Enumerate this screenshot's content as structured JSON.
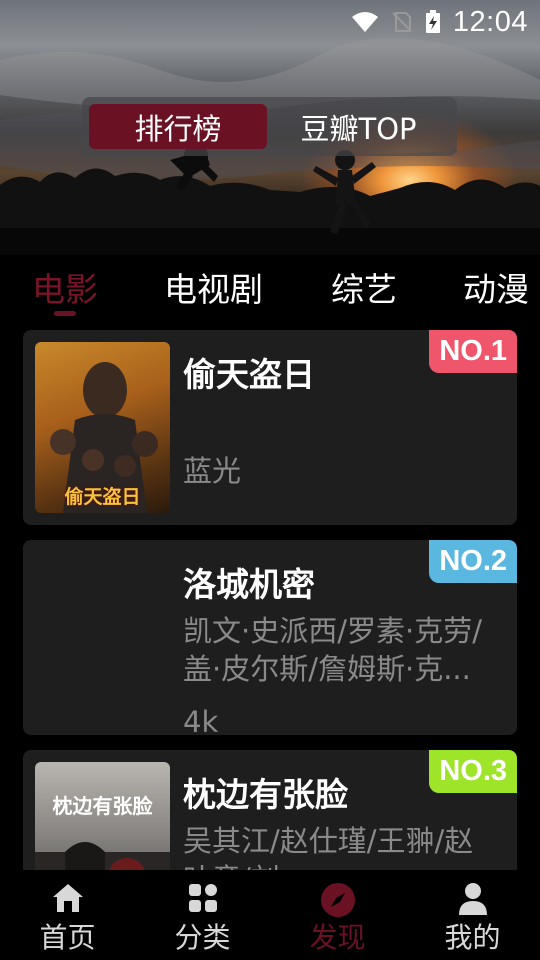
{
  "status_bar": {
    "time": "12:04"
  },
  "hero": {
    "segments": [
      {
        "label": "排行榜",
        "active": true
      },
      {
        "label": "豆瓣TOP",
        "active": false
      }
    ]
  },
  "category_tabs": [
    {
      "label": "电影",
      "active": true
    },
    {
      "label": "电视剧",
      "active": false
    },
    {
      "label": "综艺",
      "active": false
    },
    {
      "label": "动漫",
      "active": false
    }
  ],
  "rankings": [
    {
      "rank_badge": "NO.1",
      "badge_color": "#f0566b",
      "title": "偷天盗日",
      "meta_lines": [
        "蓝光"
      ],
      "poster_text": "偷天盗日"
    },
    {
      "rank_badge": "NO.2",
      "badge_color": "#5ab7e0",
      "title": "洛城机密",
      "meta_lines": [
        "凯文·史派西/罗素·克劳/",
        "盖·皮尔斯/詹姆斯·克..."
      ],
      "quality": "4k"
    },
    {
      "rank_badge": "NO.3",
      "badge_color": "#9ee52a",
      "title": "枕边有张脸",
      "meta_lines": [
        "吴其江/赵仕瑾/王翀/赵",
        "叶童/刘..."
      ],
      "poster_text": "枕边有张脸"
    }
  ],
  "bottom_nav": [
    {
      "label": "首页",
      "icon": "home-icon",
      "active": false
    },
    {
      "label": "分类",
      "icon": "grid-icon",
      "active": false
    },
    {
      "label": "发现",
      "icon": "compass-icon",
      "active": true
    },
    {
      "label": "我的",
      "icon": "person-icon",
      "active": false
    }
  ],
  "colors": {
    "accent": "#6a1123",
    "card_bg": "#1e1e1f",
    "muted_text": "#8a8a8a"
  }
}
